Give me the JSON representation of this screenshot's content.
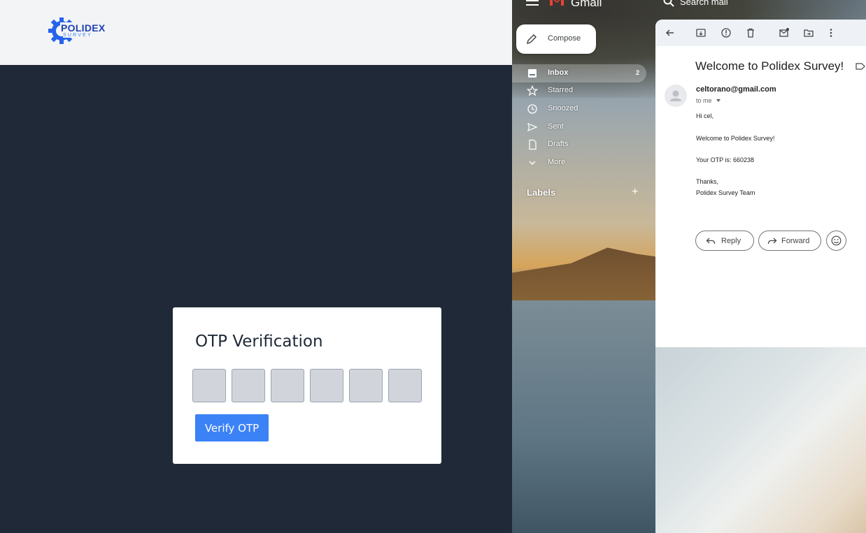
{
  "app": {
    "logo_text": "POLIDEX",
    "logo_subtext": "SURVEY",
    "brand_color": "#1e40af",
    "otp": {
      "title": "OTP Verification",
      "digit_count": 6,
      "button_label": "Verify OTP",
      "button_color": "#3b82f6"
    }
  },
  "gmail": {
    "app_name": "Gmail",
    "search_placeholder": "Search mail",
    "compose_label": "Compose",
    "nav": [
      {
        "label": "Inbox",
        "count": "2",
        "icon": "inbox-icon",
        "active": true
      },
      {
        "label": "Starred",
        "icon": "star-icon"
      },
      {
        "label": "Snoozed",
        "icon": "clock-icon"
      },
      {
        "label": "Sent",
        "icon": "send-icon"
      },
      {
        "label": "Drafts",
        "icon": "draft-icon"
      },
      {
        "label": "More",
        "icon": "chevron-down-icon"
      }
    ],
    "labels_title": "Labels",
    "message": {
      "subject": "Welcome to Polidex Survey!",
      "sender": "celtorano@gmail.com",
      "recipient": "to me",
      "body": [
        "Hi cel,",
        "Welcome to Polidex Survey!",
        "Your OTP is: 660238",
        "Thanks,",
        "Polidex Survey Team"
      ],
      "actions": {
        "reply": "Reply",
        "forward": "Forward"
      }
    }
  }
}
